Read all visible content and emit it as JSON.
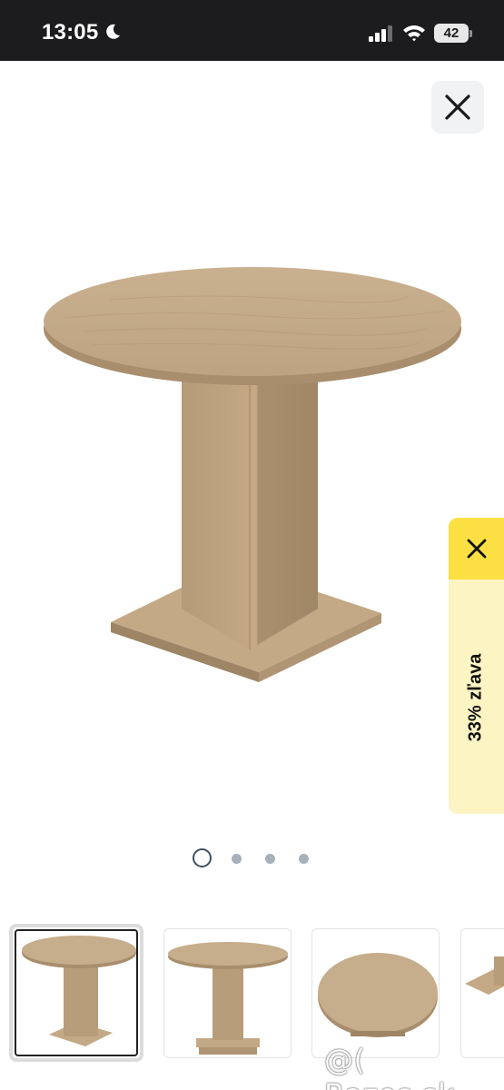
{
  "status_bar": {
    "time": "13:05",
    "battery": "42",
    "icons": [
      "moon-icon",
      "signal-icon",
      "wifi-icon",
      "battery-icon"
    ]
  },
  "close_button": {
    "icon": "close-icon"
  },
  "main_image": {
    "subject": "round-pedestal-table",
    "color": "#c2a887"
  },
  "promo": {
    "label": "33% zľava",
    "close_icon": "close-icon",
    "accent": "#fce043",
    "background": "#fdf4c4"
  },
  "pagination": {
    "total": 4,
    "active": 1
  },
  "thumbnails": [
    {
      "id": "thumb-1",
      "view": "front",
      "selected": true
    },
    {
      "id": "thumb-2",
      "view": "front-alt",
      "selected": false
    },
    {
      "id": "thumb-3",
      "view": "top",
      "selected": false
    },
    {
      "id": "thumb-4",
      "view": "detail",
      "selected": false
    }
  ],
  "watermark": "@( Bazos.sk"
}
